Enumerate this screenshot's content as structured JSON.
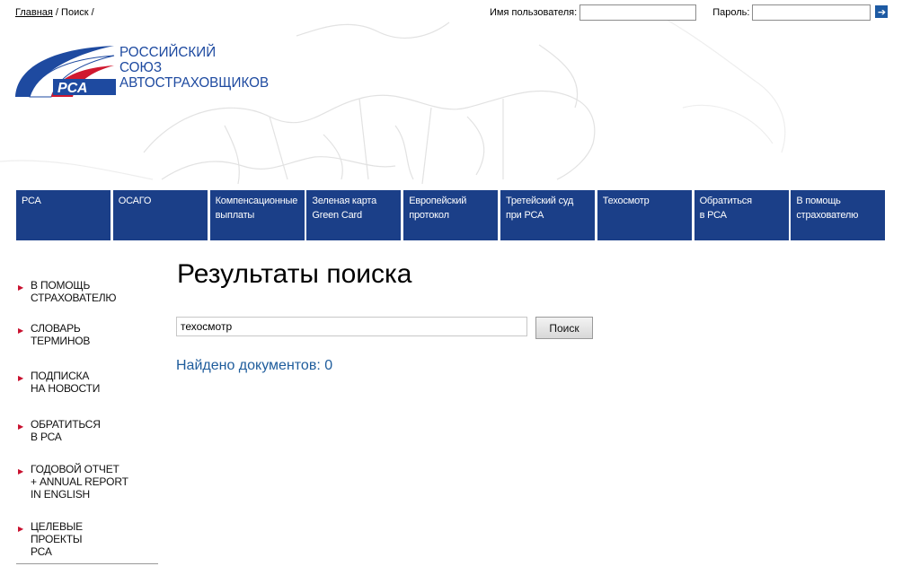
{
  "breadcrumb": {
    "home": "Главная",
    "separator1": " / ",
    "current": "Поиск",
    "separator2": " /"
  },
  "login": {
    "username_label": "Имя пользователя:",
    "username_value": "",
    "password_label": "Пароль:",
    "password_value": "",
    "submit_icon": "arrow-right-icon"
  },
  "logo": {
    "emblem_text": "РСА",
    "line1": "РОССИЙСКИЙ",
    "line2": "СОЮЗ",
    "line3": "АВТОСТРАХОВЩИКОВ"
  },
  "nav": {
    "items": [
      {
        "label": "РСА"
      },
      {
        "label": "ОСАГО"
      },
      {
        "label": "Компенсационные\nвыплаты"
      },
      {
        "label": "Зеленая карта\nGreen Card"
      },
      {
        "label": "Европейский\nпротокол"
      },
      {
        "label": "Третейский суд\nпри РСА"
      },
      {
        "label": "Техосмотр"
      },
      {
        "label": "Обратиться\nв РСА"
      },
      {
        "label": "В помощь\nстрахователю"
      }
    ]
  },
  "sidebar": {
    "items": [
      {
        "label": "В помощь\nстрахователю"
      },
      {
        "label": "Словарь\nтерминов"
      },
      {
        "label": "Подписка\nна новости"
      },
      {
        "label": "Обратиться\nв РСА"
      },
      {
        "label": "Годовой отчет\n+ Annual report\nin English"
      },
      {
        "label": "Целевые\nпроекты\nРСА"
      }
    ]
  },
  "main": {
    "title": "Результаты поиска",
    "search_value": "техосмотр",
    "search_button": "Поиск",
    "results_count": "Найдено документов: 0"
  },
  "colors": {
    "nav_bg": "#1b3f88",
    "brand_blue": "#1e4aa0",
    "accent_red": "#c8102e",
    "link_blue": "#1e5c9c"
  }
}
